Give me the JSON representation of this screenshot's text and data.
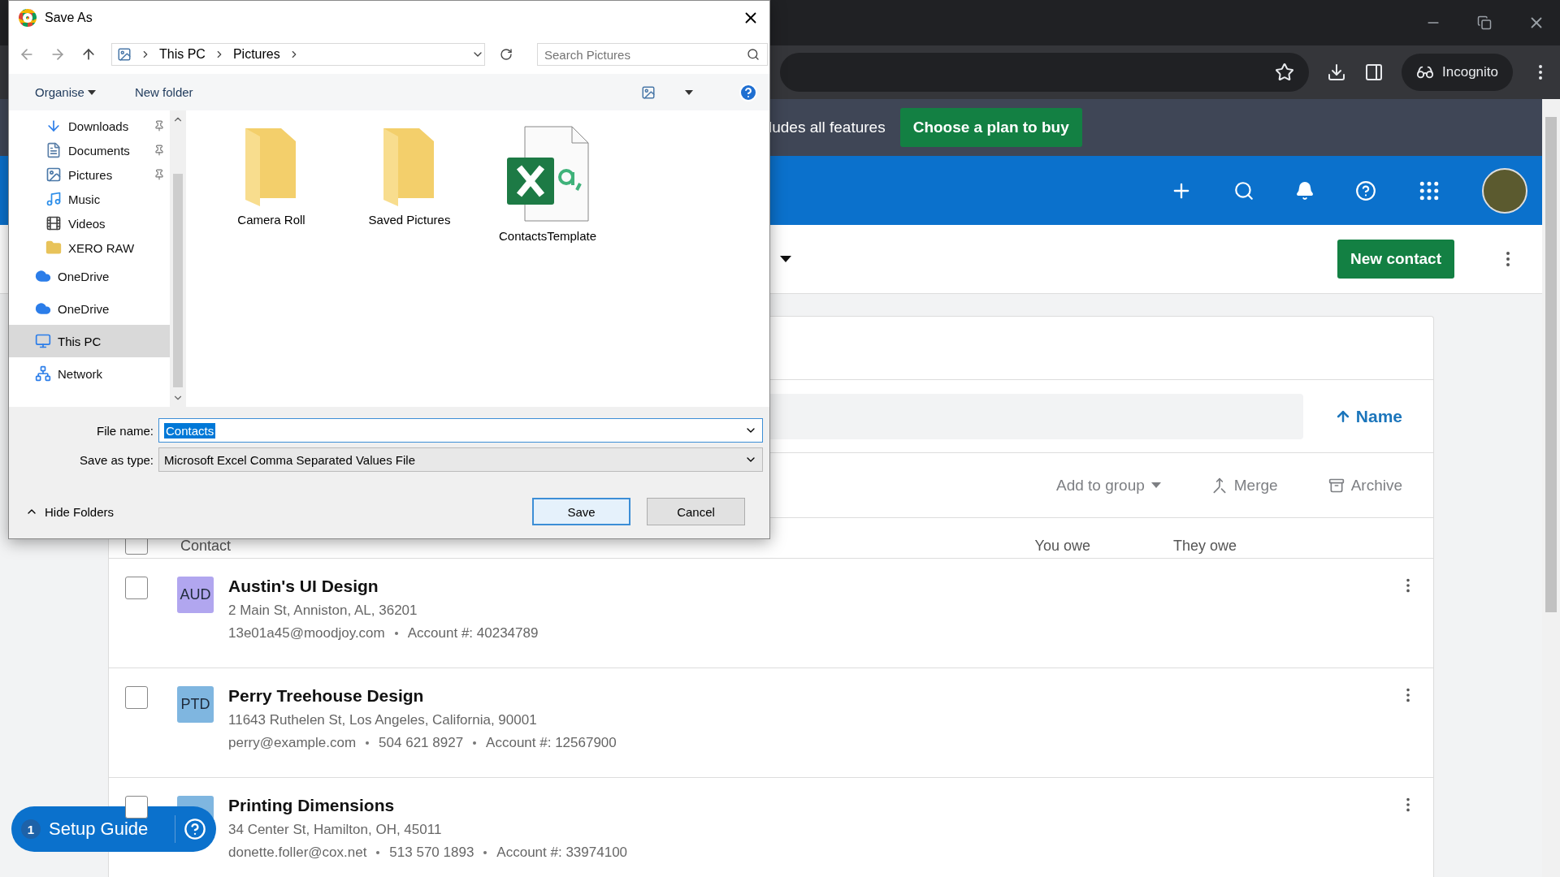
{
  "browser": {
    "incognito_label": "Incognito"
  },
  "banner": {
    "text": "ludes all features",
    "button": "Choose a plan to buy"
  },
  "page_header": {
    "button": "New contact"
  },
  "contacts": {
    "sort_label": "Name",
    "actions": [
      {
        "label": "Add to group",
        "kind": "dropdown"
      },
      {
        "label": "Merge",
        "kind": "merge"
      },
      {
        "label": "Archive",
        "kind": "archive"
      }
    ],
    "select_all": false,
    "columns": [
      "Contact",
      "You owe",
      "They owe"
    ],
    "rows": [
      {
        "initials": "AUD",
        "color": "#b1a6ef",
        "name": "Austin's UI Design",
        "address": "2 Main St, Anniston, AL, 36201",
        "details": [
          "13e01a45@moodjoy.com",
          "Account #: 40234789"
        ],
        "checked": false
      },
      {
        "initials": "PTD",
        "color": "#7fb6e0",
        "name": "Perry Treehouse Design",
        "address": "11643 Ruthelen St, Los Angeles, California, 90001",
        "details": [
          "perry@example.com",
          "504 621 8927",
          "Account #: 12567900"
        ],
        "checked": false
      },
      {
        "color": "#7fb6e0",
        "name": "Printing Dimensions",
        "address": "34 Center St, Hamilton, OH, 45011",
        "details": [
          "donette.foller@cox.net",
          "513 570 1893",
          "Account #: 33974100"
        ],
        "checked": false
      }
    ]
  },
  "setup_guide": {
    "count": "1",
    "label": "Setup Guide"
  },
  "dialog": {
    "title": "Save As",
    "breadcrumb": [
      "This PC",
      "Pictures"
    ],
    "search_placeholder": "Search Pictures",
    "commands": [
      "Organise",
      "New folder"
    ],
    "nav_items": [
      {
        "label": "Downloads",
        "kind": "download",
        "pinned": true,
        "selected": false
      },
      {
        "label": "Documents",
        "kind": "document",
        "pinned": true,
        "selected": false
      },
      {
        "label": "Pictures",
        "kind": "picture",
        "pinned": true,
        "selected": false
      },
      {
        "label": "Music",
        "kind": "music",
        "pinned": false,
        "selected": false
      },
      {
        "label": "Videos",
        "kind": "video",
        "pinned": false,
        "selected": false
      },
      {
        "label": "XERO RAW",
        "kind": "folder",
        "pinned": false,
        "selected": false
      },
      {
        "label": "OneDrive",
        "kind": "cloud",
        "pinned": false,
        "selected": false
      },
      {
        "label": "OneDrive",
        "kind": "cloud",
        "pinned": false,
        "selected": false
      },
      {
        "label": "This PC",
        "kind": "pc",
        "pinned": false,
        "selected": true
      },
      {
        "label": "Network",
        "kind": "network",
        "pinned": false,
        "selected": false
      }
    ],
    "files": [
      {
        "name": "Camera Roll",
        "kind": "folder"
      },
      {
        "name": "Saved Pictures",
        "kind": "folder"
      },
      {
        "name": "ContactsTemplate",
        "kind": "excel"
      }
    ],
    "file_name": {
      "label": "File name:",
      "value": "Contacts"
    },
    "save_type": {
      "label": "Save as type:",
      "value": "Microsoft Excel Comma Separated Values File"
    },
    "hide_folders": "Hide Folders",
    "buttons": [
      {
        "label": "Save",
        "kind": "primary"
      },
      {
        "label": "Cancel",
        "kind": "secondary"
      }
    ]
  }
}
